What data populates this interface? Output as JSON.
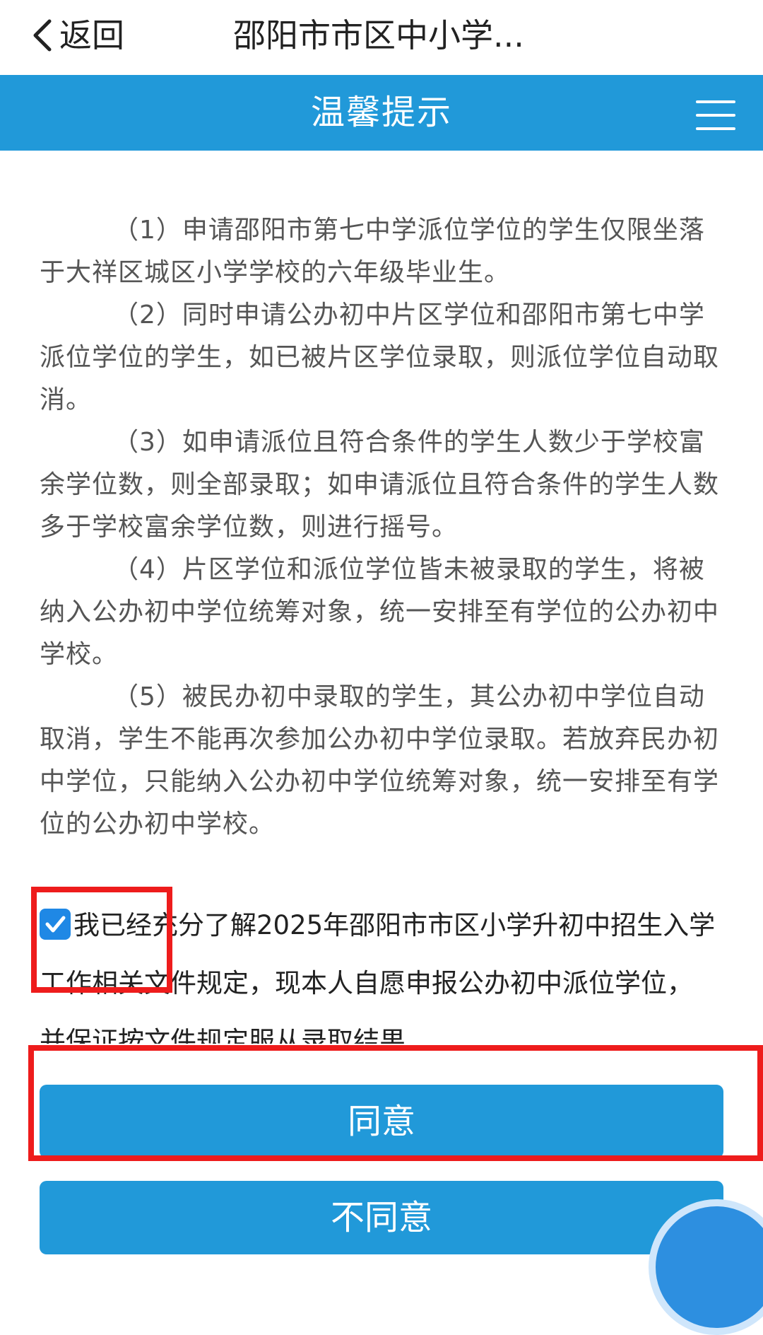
{
  "nav": {
    "back_label": "返回",
    "title": "邵阳市市区中小学..."
  },
  "header": {
    "title": "温馨提示"
  },
  "content": {
    "paragraphs": [
      "（1）申请邵阳市第七中学派位学位的学生仅限坐落于大祥区城区小学学校的六年级毕业生。",
      "（2）同时申请公办初中片区学位和邵阳市第七中学派位学位的学生，如已被片区学位录取，则派位学位自动取消。",
      "（3）如申请派位且符合条件的学生人数少于学校富余学位数，则全部录取；如申请派位且符合条件的学生人数多于学校富余学位数，则进行摇号。",
      "（4）片区学位和派位学位皆未被录取的学生，将被纳入公办初中学位统筹对象，统一安排至有学位的公办初中学校。",
      "（5）被民办初中录取的学生，其公办初中学位自动取消，学生不能再次参加公办初中学位录取。若放弃民办初中学位，只能纳入公办初中学位统筹对象，统一安排至有学位的公办初中学校。"
    ]
  },
  "agreement": {
    "checked": true,
    "text": "我已经充分了解2025年邵阳市市区小学升初中招生入学工作相关文件规定，现本人自愿申报公办初中派位学位，并保证按文件规定服从录取结果"
  },
  "buttons": {
    "agree": "同意",
    "disagree": "不同意"
  },
  "colors": {
    "header_bg": "#2199d9",
    "button_bg": "#2199d9",
    "checkbox": "#1f88e5",
    "annotation": "#ee1c1c"
  }
}
